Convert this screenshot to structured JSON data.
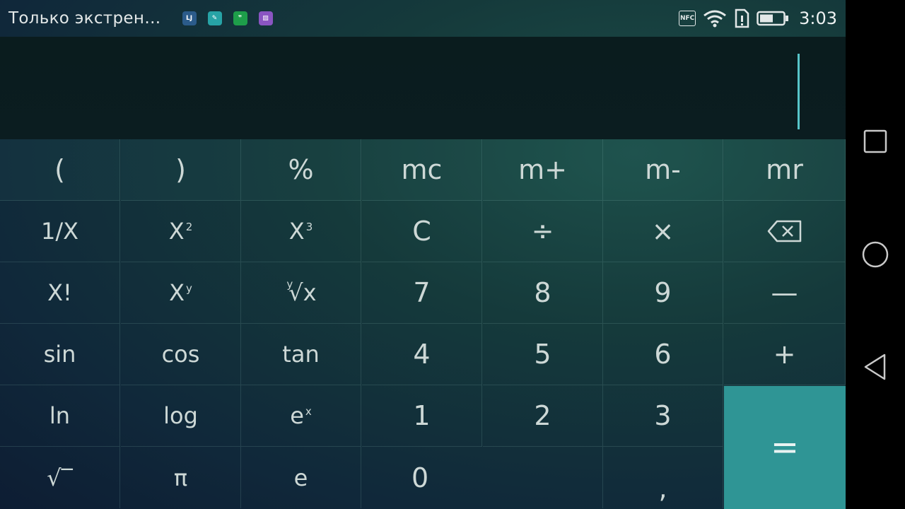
{
  "status_bar": {
    "notification_text": "Только экстрен…",
    "time": "3:03",
    "nfc_label": "NFC"
  },
  "notification_icons": [
    {
      "name": "app-icon-livejournal",
      "label": "LJ",
      "color": "#2b5b8a"
    },
    {
      "name": "app-icon-notes",
      "label": "✎",
      "color": "#27a3a6"
    },
    {
      "name": "app-icon-hangouts",
      "label": "❞",
      "color": "#1e9e4a"
    },
    {
      "name": "app-icon-gallery",
      "label": "▨",
      "color": "#8a55c2"
    }
  ],
  "keys": {
    "r1": [
      "(",
      ")",
      "%",
      "mc",
      "m+",
      "m-",
      "mr"
    ],
    "r2": [
      "1/X",
      "X",
      "X",
      "C",
      "÷",
      "×"
    ],
    "r2_sups": [
      "2",
      "3"
    ],
    "r3": [
      "X!",
      "X",
      "√x",
      "7",
      "8",
      "9",
      "—"
    ],
    "r3_sups": [
      "y",
      "y"
    ],
    "r4": [
      "sin",
      "cos",
      "tan",
      "4",
      "5",
      "6",
      "+"
    ],
    "r5": [
      "ln",
      "log",
      "e",
      "1",
      "2",
      "3"
    ],
    "r5_sups": [
      "x"
    ],
    "r6": [
      "√‾",
      "π",
      "e",
      "0",
      ","
    ],
    "equals": "="
  },
  "colors": {
    "accent": "#2f9595",
    "cursor": "#57c5c9"
  }
}
